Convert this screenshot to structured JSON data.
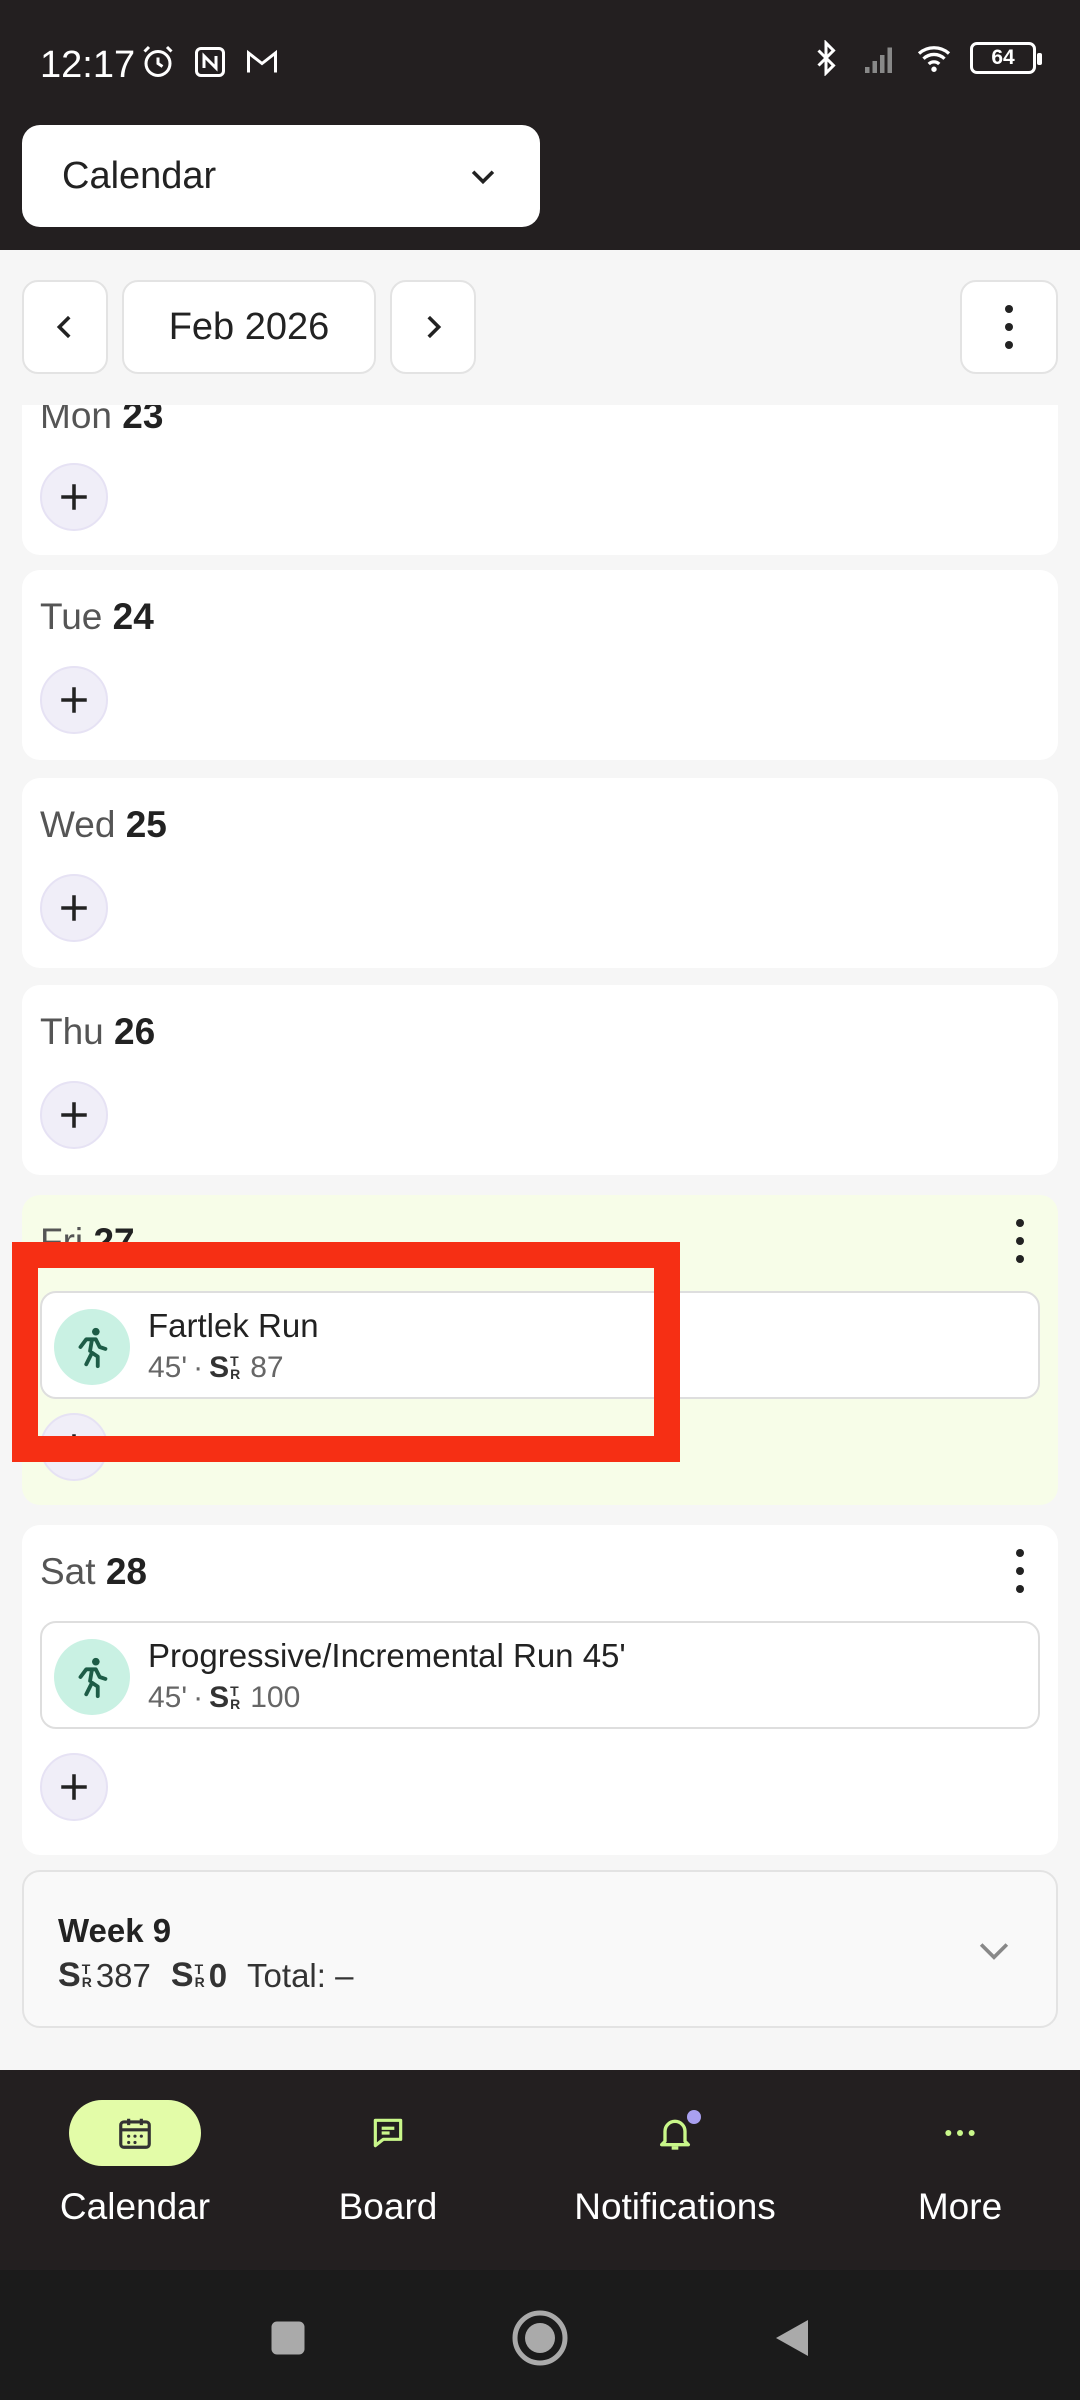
{
  "status": {
    "time": "12:17",
    "battery": "64"
  },
  "header": {
    "view_select_label": "Calendar"
  },
  "nav": {
    "month": "Feb 2026"
  },
  "days": [
    {
      "weekday": "Mon",
      "date": "23"
    },
    {
      "weekday": "Tue",
      "date": "24"
    },
    {
      "weekday": "Wed",
      "date": "25"
    },
    {
      "weekday": "Thu",
      "date": "26"
    },
    {
      "weekday": "Fri",
      "date": "27"
    },
    {
      "weekday": "Sat",
      "date": "28"
    }
  ],
  "workouts": {
    "fri": {
      "title": "Fartlek Run",
      "duration": "45'",
      "separator": "·",
      "score": "87"
    },
    "sat": {
      "title": "Progressive/Incremental Run 45'",
      "duration": "45'",
      "separator": "·",
      "score": "100"
    }
  },
  "week": {
    "title": "Week 9",
    "planned_score": "387",
    "done_score": "0",
    "total_label": "Total: –"
  },
  "score_glyph": {
    "main": "S",
    "top": "T",
    "bottom": "R"
  },
  "bottom_nav": {
    "tabs": [
      {
        "label": "Calendar",
        "icon": "calendar-icon",
        "active": true
      },
      {
        "label": "Board",
        "icon": "chat-icon",
        "active": false
      },
      {
        "label": "Notifications",
        "icon": "bell-icon",
        "active": false
      },
      {
        "label": "More",
        "icon": "more-dots-icon",
        "active": false
      }
    ]
  },
  "colors": {
    "accent": "#e3fca8",
    "highlight": "#f62f14",
    "workout_icon_bg": "#c9f1e3",
    "today_bg": "#f7fde8"
  }
}
